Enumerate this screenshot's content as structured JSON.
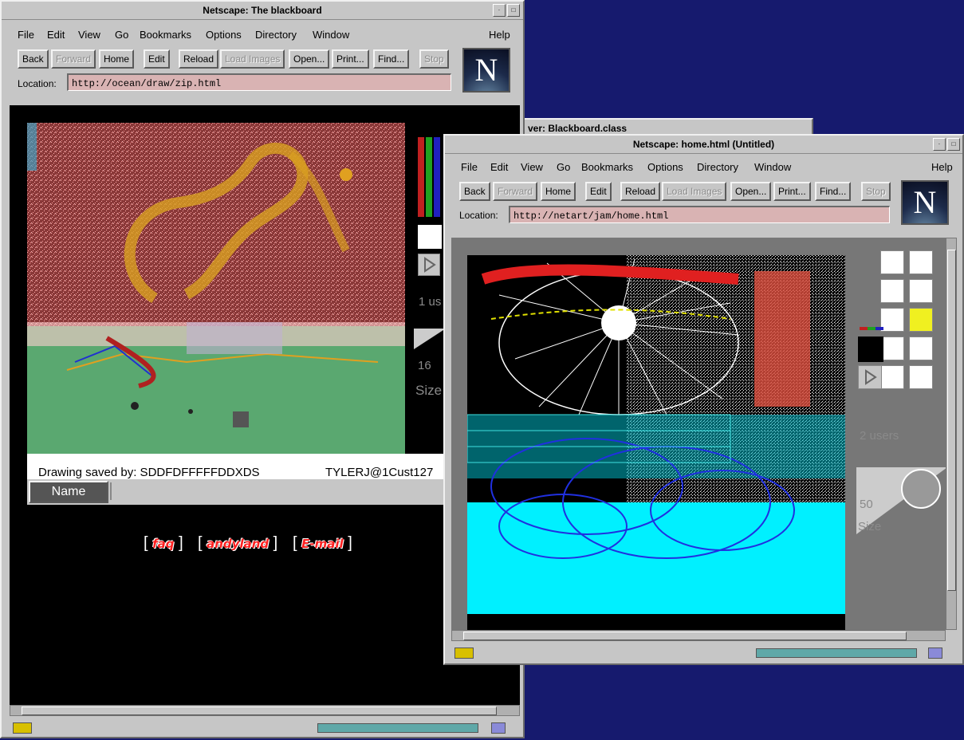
{
  "win1": {
    "title": "Netscape: The blackboard",
    "menu": [
      "File",
      "Edit",
      "View",
      "Go",
      "Bookmarks",
      "Options",
      "Directory",
      "Window",
      "Help"
    ],
    "buttons": [
      "Back",
      "Forward",
      "Home",
      "Edit",
      "Reload",
      "Load Images",
      "Open...",
      "Print...",
      "Find...",
      "Stop"
    ],
    "location_label": "Location:",
    "url": "http://ocean/draw/zip.html",
    "applet": {
      "users": "1 us",
      "size_value": "16",
      "size_label": "Size",
      "saved_by": "Drawing saved by: SDDFDFFFFFDDXDS",
      "saved_user": "TYLERJ@1Cust127",
      "name_button": "Name"
    },
    "links": [
      "faq",
      "andyland",
      "E-mail"
    ]
  },
  "win_behind": {
    "title_fragment": "ver: Blackboard.class"
  },
  "win2": {
    "title": "Netscape: home.html (Untitled)",
    "menu": [
      "File",
      "Edit",
      "View",
      "Go",
      "Bookmarks",
      "Options",
      "Directory",
      "Window",
      "Help"
    ],
    "buttons": [
      "Back",
      "Forward",
      "Home",
      "Edit",
      "Reload",
      "Load Images",
      "Open...",
      "Print...",
      "Find...",
      "Stop"
    ],
    "location_label": "Location:",
    "url": "http://netart/jam/home.html",
    "applet": {
      "users": "2 users",
      "size_value": "50",
      "size_label": "Size"
    }
  },
  "logo_letter": "N",
  "colors": {
    "desktop": "#161a6e",
    "location_bg": "#d9b3b3",
    "canvas_green": "#5aa870",
    "canvas_cyan": "#00f0ff"
  }
}
